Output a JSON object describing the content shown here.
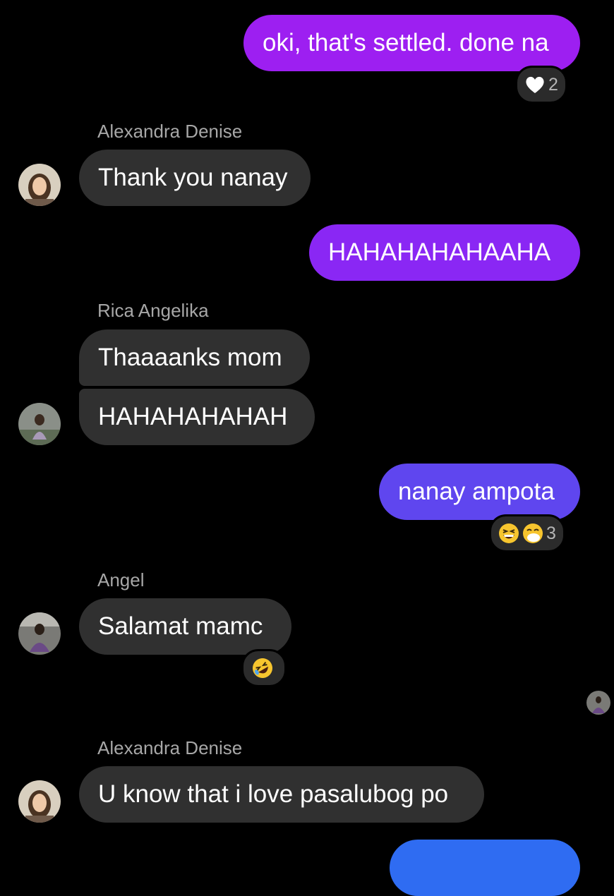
{
  "messages": [
    {
      "text": "oki, that's settled. done na",
      "from": "me",
      "reactions": {
        "icons": [
          "heart-icon"
        ],
        "count": "2"
      }
    },
    {
      "sender": "Alexandra Denise",
      "text": "Thank you nanay"
    },
    {
      "text": "HAHAHAHAHAAHA",
      "from": "me"
    },
    {
      "sender": "Rica Angelika",
      "texts": [
        "Thaaaanks mom",
        "HAHAHAHAHAH"
      ]
    },
    {
      "text": "nanay ampota",
      "from": "me",
      "reactions": {
        "icons": [
          "grinning-squinting-face-icon",
          "face-with-hand-over-mouth-icon"
        ],
        "count": "3"
      }
    },
    {
      "sender": "Angel",
      "text": "Salamat mamc",
      "reactions": {
        "icons": [
          "rolling-on-floor-laughing-icon"
        ],
        "count": ""
      }
    },
    {
      "seen_avatar": "seen-receipt-avatar"
    },
    {
      "sender": "Alexandra Denise",
      "text": "U know that i love pasalubog po"
    }
  ],
  "colors": {
    "outgoing_1": "#9d1ff1",
    "outgoing_2": "#8a27f4",
    "outgoing_3": "#5f46ef",
    "outgoing_4": "#2f6cf2",
    "incoming": "#303030",
    "background": "#000000"
  }
}
